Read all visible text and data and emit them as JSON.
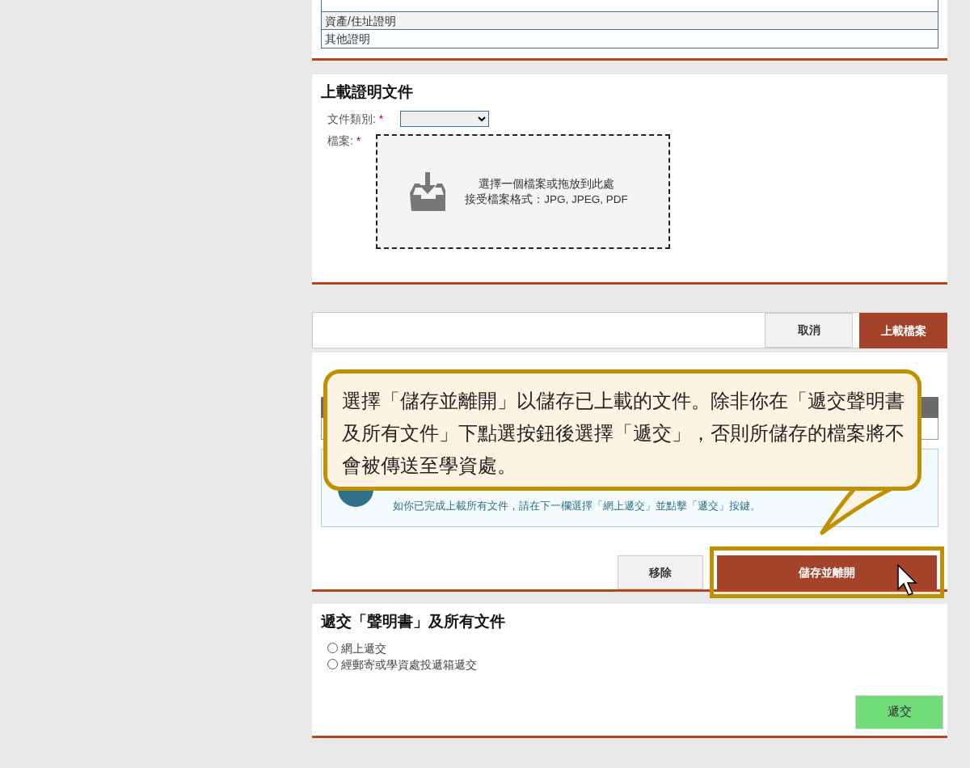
{
  "proof_list": {
    "rows": [
      {
        "text": "資產/住址證明",
        "selected": true
      },
      {
        "text": "其他證明",
        "selected": false
      }
    ]
  },
  "upload_section": {
    "title": "上載證明文件",
    "fields": [
      {
        "kind": "select",
        "label": "文件類別:",
        "required_mark": "*"
      },
      {
        "kind": "dropzone",
        "label": "檔案:",
        "required_mark": "*",
        "lines": [
          "選擇一個檔案或拖放到此處",
          "接受檔案格式：JPG, JPEG, PDF"
        ]
      }
    ]
  },
  "upload_bar": {
    "buttons": [
      {
        "label": "取消",
        "kind": "secondary"
      },
      {
        "label": "上載檔案",
        "kind": "primary"
      }
    ]
  },
  "documents": {
    "alert": "如你已完成上載所有文件，請在下一欄選擇「網上遞交」並點擊「遞交」按鍵。",
    "buttons": [
      {
        "label": "移除",
        "kind": "secondary",
        "highlighted": false
      },
      {
        "label": "儲存並離開",
        "kind": "primary",
        "highlighted": true
      }
    ]
  },
  "callout": {
    "text": "選擇「儲存並離開」以儲存已上載的文件。除非你在「遞交聲明書及所有文件」下點選按鈕後選擇「遞交」，否則所儲存的檔案將不會被傳送至學資處。"
  },
  "submit_section": {
    "title": "遞交「聲明書」及所有文件",
    "options": [
      {
        "label": "網上遞交",
        "selected": false
      },
      {
        "label": "經郵寄或學資處投遞箱遞交",
        "selected": false
      }
    ],
    "button": {
      "label": "遞交"
    }
  }
}
